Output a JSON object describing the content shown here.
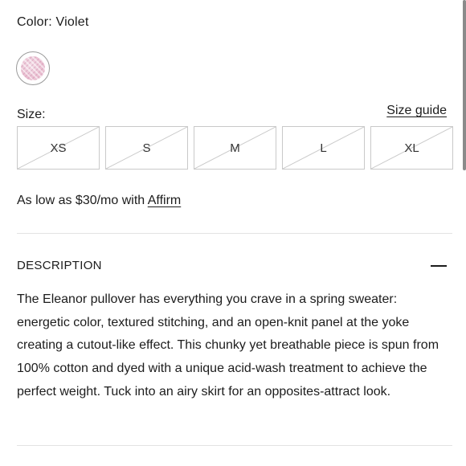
{
  "color": {
    "label": "Color: Violet",
    "swatch_icon": "violet-swatch-icon",
    "swatch_color": "#e9bccf"
  },
  "size": {
    "label": "Size:",
    "guide_link": "Size guide",
    "options": [
      {
        "label": "XS",
        "available": false
      },
      {
        "label": "S",
        "available": false
      },
      {
        "label": "M",
        "available": false
      },
      {
        "label": "L",
        "available": false
      },
      {
        "label": "XL",
        "available": false
      }
    ]
  },
  "financing": {
    "prefix": "As low as $30/mo with ",
    "link": "Affirm"
  },
  "description": {
    "heading": "DESCRIPTION",
    "toggle_icon": "minus-icon",
    "body": "The Eleanor pullover has everything you crave in a spring sweater: energetic color, textured stitching, and an open-knit panel at the yoke creating a cutout-like effect. This chunky yet breathable piece is spun from 100% cotton and dyed with a unique acid-wash treatment to achieve the perfect weight. Tuck into an airy skirt for an opposites-attract look."
  },
  "colors": {
    "text": "#1c1c1c",
    "border": "#c9c9c9",
    "divider": "#e3e3e3"
  }
}
